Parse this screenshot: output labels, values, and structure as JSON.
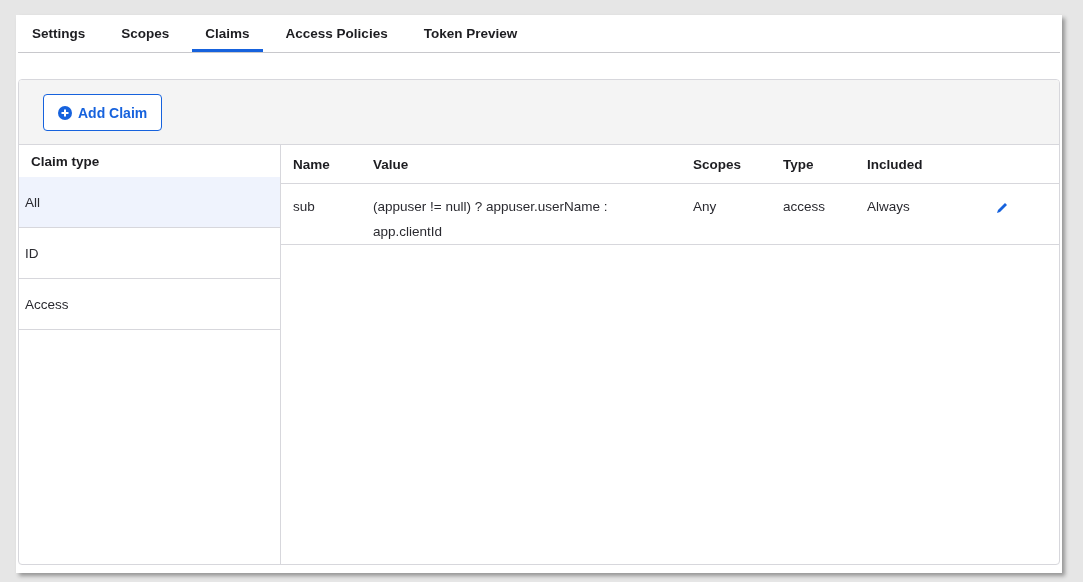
{
  "tabs": [
    {
      "label": "Settings",
      "selected": false
    },
    {
      "label": "Scopes",
      "selected": false
    },
    {
      "label": "Claims",
      "selected": true
    },
    {
      "label": "Access Policies",
      "selected": false
    },
    {
      "label": "Token Preview",
      "selected": false
    }
  ],
  "add_button": {
    "label": "Add Claim"
  },
  "claim_types": {
    "heading": "Claim type",
    "items": [
      {
        "label": "All",
        "selected": true
      },
      {
        "label": "ID",
        "selected": false
      },
      {
        "label": "Access",
        "selected": false
      }
    ]
  },
  "table": {
    "columns": [
      "Name",
      "Value",
      "Scopes",
      "Type",
      "Included"
    ],
    "rows": [
      {
        "cells": [
          "sub",
          "(appuser != null) ? appuser.userName : app.clientId",
          "Any",
          "access",
          "Always"
        ]
      }
    ]
  }
}
